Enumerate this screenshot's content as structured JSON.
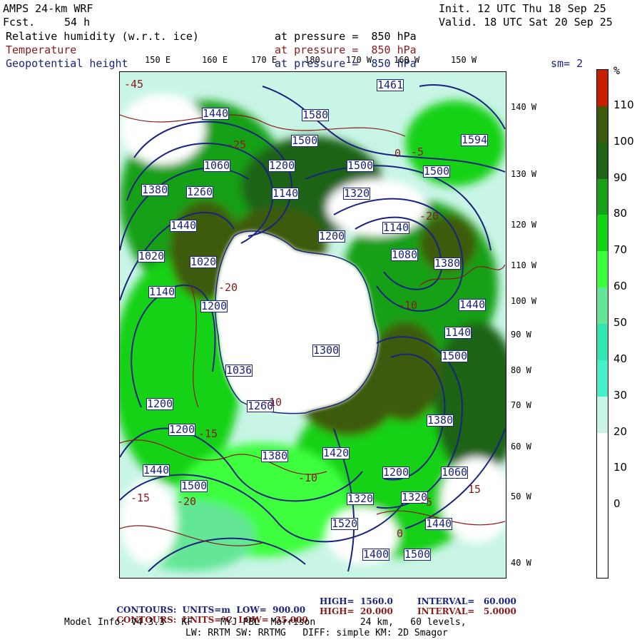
{
  "header": {
    "model": "AMPS 24-km WRF",
    "fcst_label": "Fcst.",
    "fcst_value": "54 h",
    "init": "Init. 12 UTC Thu 18 Sep 25",
    "valid": "Valid. 18 UTC Sat 20 Sep 25"
  },
  "fields": [
    {
      "name": "Relative humidity (w.r.t. ice)",
      "level": "at pressure =  850 hPa",
      "color": "#000000"
    },
    {
      "name": "Temperature",
      "level": "at pressure =  850 hPa",
      "color": "#8b1a1a"
    },
    {
      "name": "Geopotential height",
      "level": "at pressure =  850 hPa",
      "color": "#1a237e"
    }
  ],
  "smoothing": "sm= 2",
  "top_lon_labels": [
    "150 E",
    "160 E",
    "170 E",
    "180",
    "170 W",
    "160 W",
    "150 W"
  ],
  "right_lon_labels": [
    "140 W",
    "130 W",
    "120 W",
    "110 W",
    "100 W",
    "90 W",
    "80 W",
    "70 W",
    "60 W",
    "50 W",
    "40 W"
  ],
  "colorbar": {
    "unit": "%",
    "ticks": [
      "110",
      "100",
      "90",
      "80",
      "70",
      "60",
      "50",
      "40",
      "30",
      "20",
      "10",
      "0"
    ],
    "colors": [
      "#c81e00",
      "#3d5a0a",
      "#1e6414",
      "#19a019",
      "#14d214",
      "#3cff3c",
      "#64e696",
      "#32e6b4",
      "#46f0c8",
      "#c8f5e6",
      "#ffffff",
      "#ffffff",
      "#ffffff",
      "#ffffff"
    ]
  },
  "height_labels": [
    "1461",
    "1580",
    "1500",
    "1594",
    "1440",
    "1060",
    "1200",
    "1140",
    "1500",
    "1380",
    "1260",
    "1320",
    "1500",
    "1140",
    "1440",
    "1200",
    "1080",
    "1380",
    "1020",
    "1020",
    "1300",
    "1200",
    "1140",
    "1140",
    "1440",
    "1500",
    "1200",
    "1380",
    "1440",
    "1036",
    "1260",
    "1200",
    "1500",
    "1380",
    "1320",
    "1500",
    "1400",
    "1520",
    "1320",
    "1420",
    "1440",
    "1200",
    "1060",
    "1320"
  ],
  "temp_labels": [
    "-45",
    "-25",
    "-20",
    "-10",
    "0",
    "-5",
    "-15",
    "-20",
    "-10",
    "-5",
    "-15",
    "-20",
    "-10",
    "0",
    "15"
  ],
  "footer": {
    "height_contours": {
      "label": "CONTOURS:",
      "units": "UNITS=m",
      "low": "LOW=  900.00",
      "high": "HIGH=  1560.0",
      "interval": "INTERVAL=   60.000"
    },
    "temp_contours": {
      "label": "CONTOURS:",
      "units": "UNITS=°C",
      "low": "LOW= -35.000",
      "high": "HIGH=  20.000",
      "interval": "INTERVAL=   5.0000"
    },
    "model_info": "Model Info: V4.3.3   KF     MYJ PBL  Morrison        24 km,   60 levels,",
    "model_info2": "LW: RRTM SW: RRTMG   DIFF: simple KM: 2D Smagor"
  },
  "colors": {
    "height": "#1a237e",
    "temp": "#8b1a1a",
    "land": "#ffffff"
  }
}
